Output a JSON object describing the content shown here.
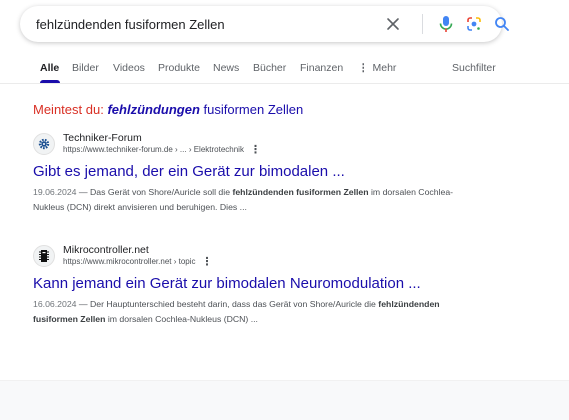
{
  "search": {
    "query": "fehlzündenden fusiformen Zellen"
  },
  "icons": {
    "clear": "close-icon",
    "mic": "microphone-icon",
    "lens": "google-lens-icon",
    "search": "magnifier-icon"
  },
  "colors": {
    "link": "#1a0dab",
    "correction": "#d93025",
    "mic_blue": "#4285f4",
    "mic_red": "#ea4335"
  },
  "tabs": [
    {
      "label": "Alle",
      "active": true
    },
    {
      "label": "Bilder"
    },
    {
      "label": "Videos"
    },
    {
      "label": "Produkte"
    },
    {
      "label": "News"
    },
    {
      "label": "Bücher"
    },
    {
      "label": "Finanzen"
    },
    {
      "label": "Mehr"
    }
  ],
  "search_tools": "Suchfilter",
  "did_you_mean": {
    "label": "Meintest du:",
    "correction_bold": "fehlzündungen",
    "correction_rest": "fusiformen Zellen"
  },
  "results": [
    {
      "site_name": "Techniker-Forum",
      "url": "https://www.techniker-forum.de › ... › Elektrotechnik",
      "title": "Gibt es jemand, der ein Gerät zur bimodalen ...",
      "date": "19.06.2024",
      "snippet_pre": " — Das Gerät von Shore/Auricle soll die ",
      "snippet_bold": "fehlzündenden fusiformen Zellen",
      "snippet_post": " im dorsalen Cochlea-Nukleus (DCN) direkt anvisieren und beruhigen. Dies ..."
    },
    {
      "site_name": "Mikrocontroller.net",
      "url": "https://www.mikrocontroller.net › topic",
      "title": "Kann jemand ein Gerät zur bimodalen Neuromodulation ...",
      "date": "16.06.2024",
      "snippet_pre": " — Der Hauptunterschied besteht darin, dass das Gerät von Shore/Auricle die ",
      "snippet_bold": "fehlzündenden fusiformen Zellen",
      "snippet_post": " im dorsalen Cochlea-Nukleus (DCN) ..."
    }
  ]
}
